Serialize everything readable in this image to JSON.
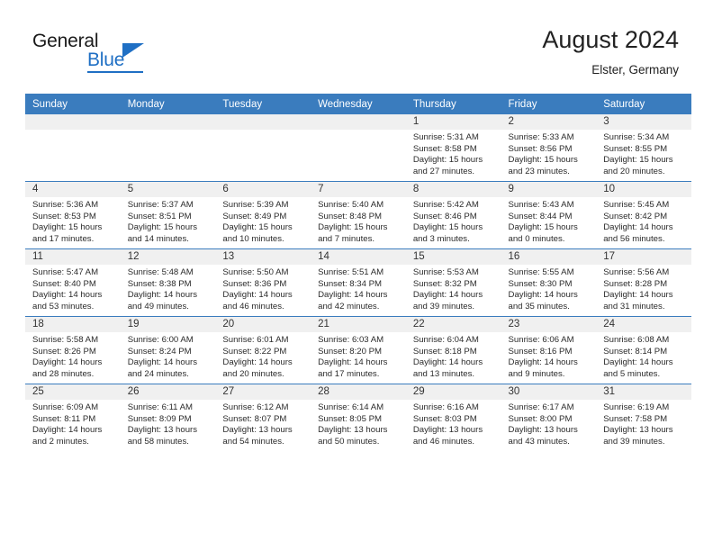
{
  "logo": {
    "word1": "General",
    "word2": "Blue",
    "triangle_color": "#1f6fc4"
  },
  "header": {
    "title": "August 2024",
    "subtitle": "Elster, Germany"
  },
  "theme": {
    "header_bg": "#3a7cbe",
    "daynum_bg": "#f0f0f0",
    "grid_line": "#3a7cbe",
    "text": "#2b2b2b"
  },
  "weekday_headers": [
    "Sunday",
    "Monday",
    "Tuesday",
    "Wednesday",
    "Thursday",
    "Friday",
    "Saturday"
  ],
  "weeks": [
    [
      {
        "day": "",
        "sunrise": "",
        "sunset": "",
        "daylight": "",
        "empty": true
      },
      {
        "day": "",
        "sunrise": "",
        "sunset": "",
        "daylight": "",
        "empty": true
      },
      {
        "day": "",
        "sunrise": "",
        "sunset": "",
        "daylight": "",
        "empty": true
      },
      {
        "day": "",
        "sunrise": "",
        "sunset": "",
        "daylight": "",
        "empty": true
      },
      {
        "day": "1",
        "sunrise": "Sunrise: 5:31 AM",
        "sunset": "Sunset: 8:58 PM",
        "daylight": "Daylight: 15 hours and 27 minutes."
      },
      {
        "day": "2",
        "sunrise": "Sunrise: 5:33 AM",
        "sunset": "Sunset: 8:56 PM",
        "daylight": "Daylight: 15 hours and 23 minutes."
      },
      {
        "day": "3",
        "sunrise": "Sunrise: 5:34 AM",
        "sunset": "Sunset: 8:55 PM",
        "daylight": "Daylight: 15 hours and 20 minutes."
      }
    ],
    [
      {
        "day": "4",
        "sunrise": "Sunrise: 5:36 AM",
        "sunset": "Sunset: 8:53 PM",
        "daylight": "Daylight: 15 hours and 17 minutes."
      },
      {
        "day": "5",
        "sunrise": "Sunrise: 5:37 AM",
        "sunset": "Sunset: 8:51 PM",
        "daylight": "Daylight: 15 hours and 14 minutes."
      },
      {
        "day": "6",
        "sunrise": "Sunrise: 5:39 AM",
        "sunset": "Sunset: 8:49 PM",
        "daylight": "Daylight: 15 hours and 10 minutes."
      },
      {
        "day": "7",
        "sunrise": "Sunrise: 5:40 AM",
        "sunset": "Sunset: 8:48 PM",
        "daylight": "Daylight: 15 hours and 7 minutes."
      },
      {
        "day": "8",
        "sunrise": "Sunrise: 5:42 AM",
        "sunset": "Sunset: 8:46 PM",
        "daylight": "Daylight: 15 hours and 3 minutes."
      },
      {
        "day": "9",
        "sunrise": "Sunrise: 5:43 AM",
        "sunset": "Sunset: 8:44 PM",
        "daylight": "Daylight: 15 hours and 0 minutes."
      },
      {
        "day": "10",
        "sunrise": "Sunrise: 5:45 AM",
        "sunset": "Sunset: 8:42 PM",
        "daylight": "Daylight: 14 hours and 56 minutes."
      }
    ],
    [
      {
        "day": "11",
        "sunrise": "Sunrise: 5:47 AM",
        "sunset": "Sunset: 8:40 PM",
        "daylight": "Daylight: 14 hours and 53 minutes."
      },
      {
        "day": "12",
        "sunrise": "Sunrise: 5:48 AM",
        "sunset": "Sunset: 8:38 PM",
        "daylight": "Daylight: 14 hours and 49 minutes."
      },
      {
        "day": "13",
        "sunrise": "Sunrise: 5:50 AM",
        "sunset": "Sunset: 8:36 PM",
        "daylight": "Daylight: 14 hours and 46 minutes."
      },
      {
        "day": "14",
        "sunrise": "Sunrise: 5:51 AM",
        "sunset": "Sunset: 8:34 PM",
        "daylight": "Daylight: 14 hours and 42 minutes."
      },
      {
        "day": "15",
        "sunrise": "Sunrise: 5:53 AM",
        "sunset": "Sunset: 8:32 PM",
        "daylight": "Daylight: 14 hours and 39 minutes."
      },
      {
        "day": "16",
        "sunrise": "Sunrise: 5:55 AM",
        "sunset": "Sunset: 8:30 PM",
        "daylight": "Daylight: 14 hours and 35 minutes."
      },
      {
        "day": "17",
        "sunrise": "Sunrise: 5:56 AM",
        "sunset": "Sunset: 8:28 PM",
        "daylight": "Daylight: 14 hours and 31 minutes."
      }
    ],
    [
      {
        "day": "18",
        "sunrise": "Sunrise: 5:58 AM",
        "sunset": "Sunset: 8:26 PM",
        "daylight": "Daylight: 14 hours and 28 minutes."
      },
      {
        "day": "19",
        "sunrise": "Sunrise: 6:00 AM",
        "sunset": "Sunset: 8:24 PM",
        "daylight": "Daylight: 14 hours and 24 minutes."
      },
      {
        "day": "20",
        "sunrise": "Sunrise: 6:01 AM",
        "sunset": "Sunset: 8:22 PM",
        "daylight": "Daylight: 14 hours and 20 minutes."
      },
      {
        "day": "21",
        "sunrise": "Sunrise: 6:03 AM",
        "sunset": "Sunset: 8:20 PM",
        "daylight": "Daylight: 14 hours and 17 minutes."
      },
      {
        "day": "22",
        "sunrise": "Sunrise: 6:04 AM",
        "sunset": "Sunset: 8:18 PM",
        "daylight": "Daylight: 14 hours and 13 minutes."
      },
      {
        "day": "23",
        "sunrise": "Sunrise: 6:06 AM",
        "sunset": "Sunset: 8:16 PM",
        "daylight": "Daylight: 14 hours and 9 minutes."
      },
      {
        "day": "24",
        "sunrise": "Sunrise: 6:08 AM",
        "sunset": "Sunset: 8:14 PM",
        "daylight": "Daylight: 14 hours and 5 minutes."
      }
    ],
    [
      {
        "day": "25",
        "sunrise": "Sunrise: 6:09 AM",
        "sunset": "Sunset: 8:11 PM",
        "daylight": "Daylight: 14 hours and 2 minutes."
      },
      {
        "day": "26",
        "sunrise": "Sunrise: 6:11 AM",
        "sunset": "Sunset: 8:09 PM",
        "daylight": "Daylight: 13 hours and 58 minutes."
      },
      {
        "day": "27",
        "sunrise": "Sunrise: 6:12 AM",
        "sunset": "Sunset: 8:07 PM",
        "daylight": "Daylight: 13 hours and 54 minutes."
      },
      {
        "day": "28",
        "sunrise": "Sunrise: 6:14 AM",
        "sunset": "Sunset: 8:05 PM",
        "daylight": "Daylight: 13 hours and 50 minutes."
      },
      {
        "day": "29",
        "sunrise": "Sunrise: 6:16 AM",
        "sunset": "Sunset: 8:03 PM",
        "daylight": "Daylight: 13 hours and 46 minutes."
      },
      {
        "day": "30",
        "sunrise": "Sunrise: 6:17 AM",
        "sunset": "Sunset: 8:00 PM",
        "daylight": "Daylight: 13 hours and 43 minutes."
      },
      {
        "day": "31",
        "sunrise": "Sunrise: 6:19 AM",
        "sunset": "Sunset: 7:58 PM",
        "daylight": "Daylight: 13 hours and 39 minutes."
      }
    ]
  ]
}
